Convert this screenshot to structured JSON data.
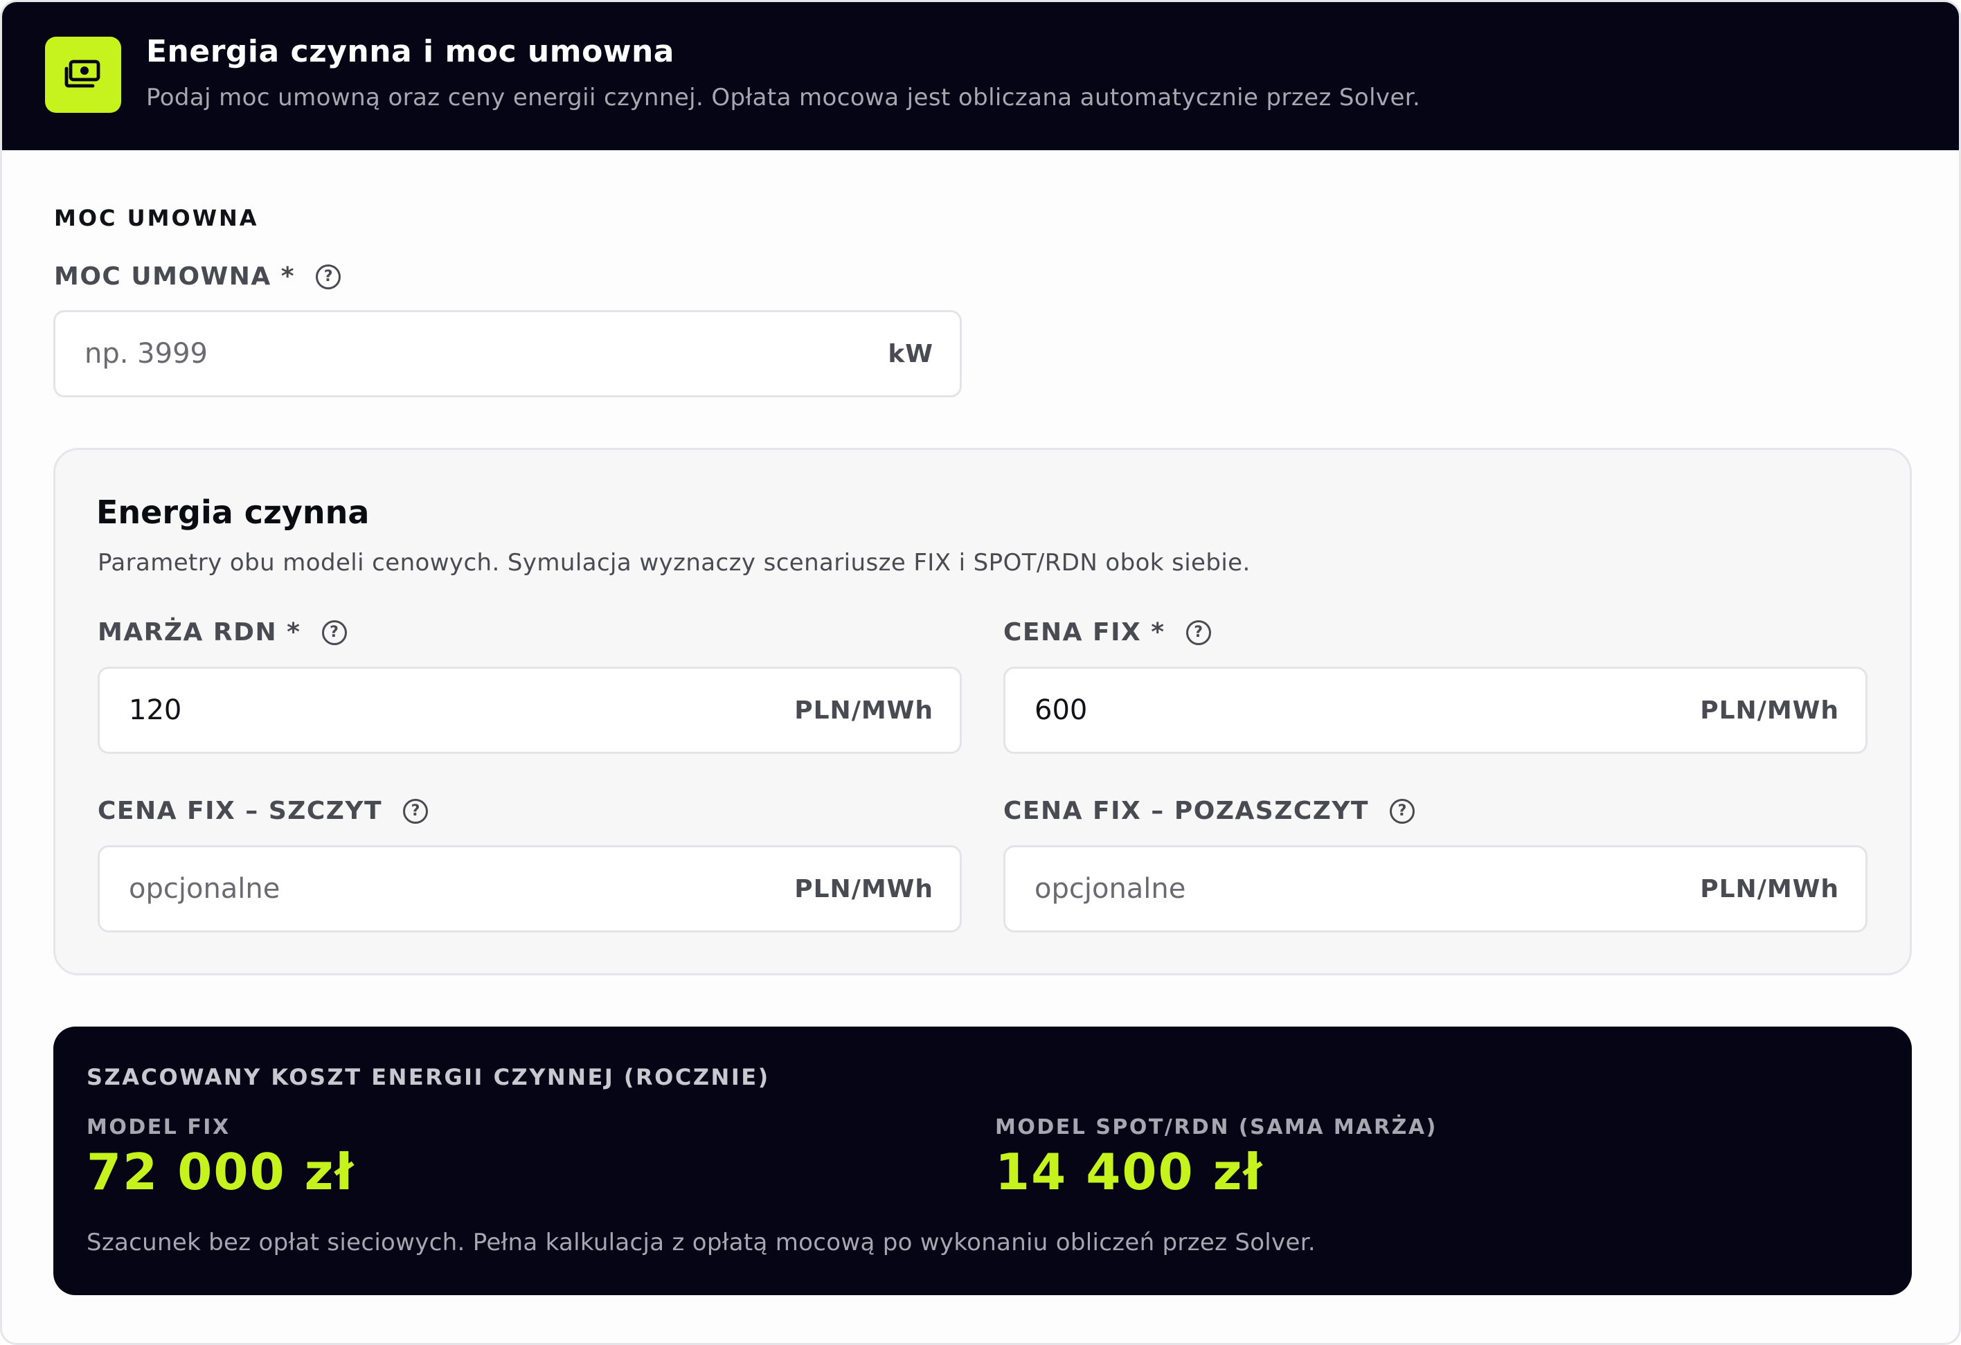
{
  "header": {
    "icon": "banknote-icon",
    "title": "Energia czynna i moc umowna",
    "subtitle": "Podaj moc umowną oraz ceny energii czynnej. Opłata mocowa jest obliczana automatycznie przez Solver."
  },
  "moc_umowna": {
    "section_title": "MOC UMOWNA",
    "field_label": "MOC UMOWNA *",
    "placeholder": "np. 3999",
    "value": "",
    "unit": "kW"
  },
  "energia_czynna": {
    "title": "Energia czynna",
    "description": "Parametry obu modeli cenowych. Symulacja wyznaczy scenariusze FIX i SPOT/RDN obok siebie.",
    "fields": {
      "marza_rdn": {
        "label": "MARŻA RDN *",
        "value": "120",
        "placeholder": "",
        "unit": "PLN/MWh"
      },
      "cena_fix": {
        "label": "CENA FIX *",
        "value": "600",
        "placeholder": "",
        "unit": "PLN/MWh"
      },
      "cena_fix_szczyt": {
        "label": "CENA FIX – SZCZYT",
        "value": "",
        "placeholder": "opcjonalne",
        "unit": "PLN/MWh"
      },
      "cena_fix_pozaszczyt": {
        "label": "CENA FIX – POZASZCZYT",
        "value": "",
        "placeholder": "opcjonalne",
        "unit": "PLN/MWh"
      }
    }
  },
  "summary": {
    "title": "SZACOWANY KOSZT ENERGII CZYNNEJ (ROCZNIE)",
    "fix_label": "MODEL FIX",
    "fix_value": "72 000 zł",
    "spot_label": "MODEL SPOT/RDN (SAMA MARŻA)",
    "spot_value": "14 400 zł",
    "note": "Szacunek bez opłat sieciowych. Pełna kalkulacja z opłatą mocową po wykonaniu obliczeń przez Solver."
  },
  "colors": {
    "dark": "#060516",
    "accent": "#c6f21e"
  }
}
